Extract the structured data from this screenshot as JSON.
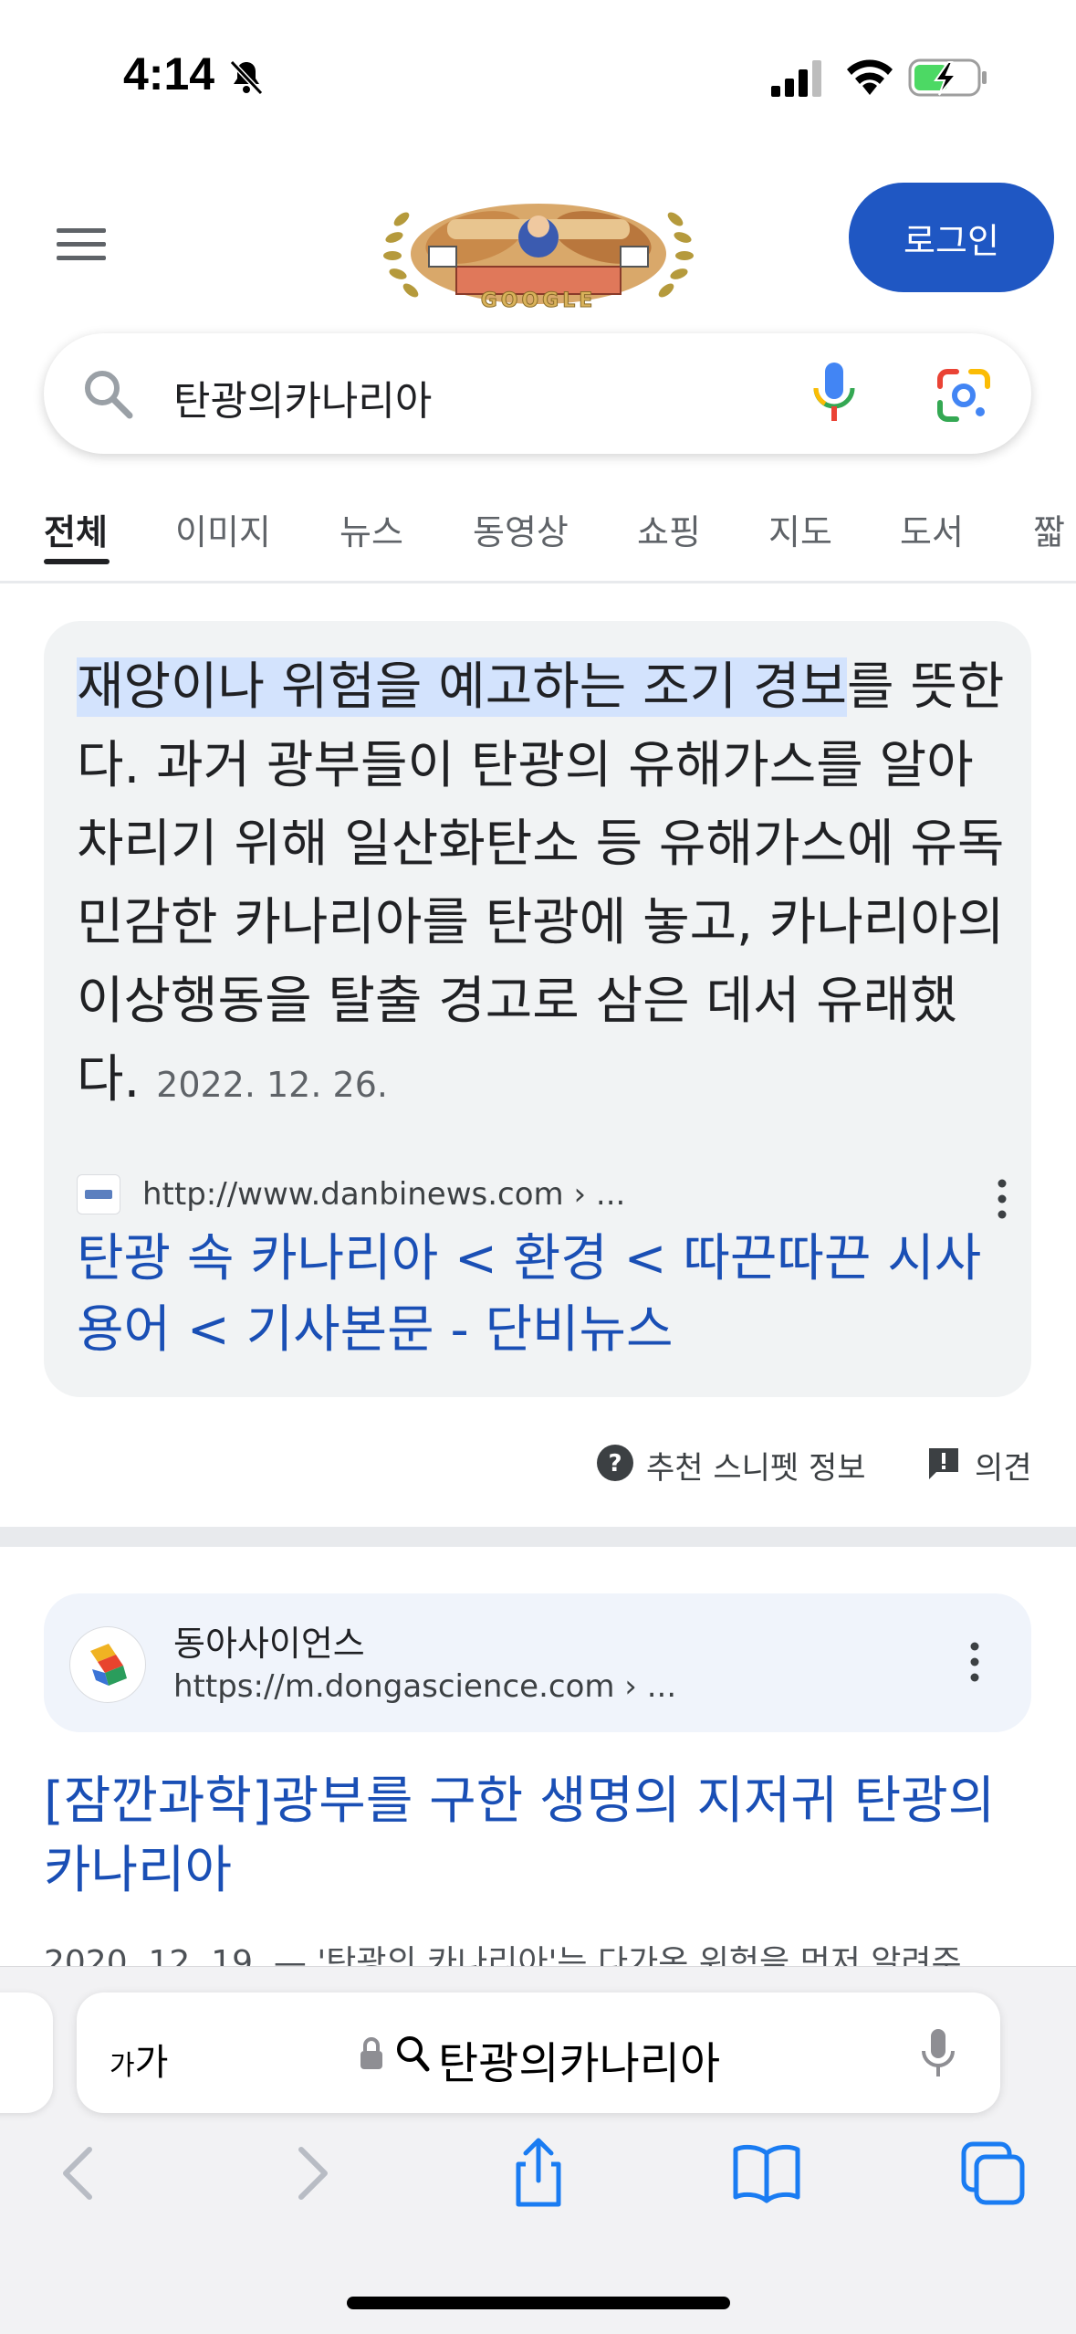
{
  "status_bar": {
    "time": "4:14"
  },
  "header": {
    "login_label": "로그인",
    "logo_text": "GOOGLE"
  },
  "search": {
    "query": "탄광의카나리아"
  },
  "tabs": [
    {
      "label": "전체"
    },
    {
      "label": "이미지"
    },
    {
      "label": "뉴스"
    },
    {
      "label": "동영상"
    },
    {
      "label": "쇼핑"
    },
    {
      "label": "지도"
    },
    {
      "label": "도서"
    },
    {
      "label": "짧"
    }
  ],
  "featured_snippet": {
    "highlighted_text": "재앙이나 위험을 예고하는 조기 경보",
    "body_text": "를 뜻한다. 과거 광부들이 탄광의 유해가스를 알아차리기 위해 일산화탄소 등 유해가스에 유독 민감한 카나리아를 탄광에 놓고, 카나리아의 이상행동을 탈출 경고로 삼은 데서 유래했다.",
    "date": "2022. 12. 26.",
    "source_url": "http://www.danbinews.com › ...",
    "link_title": "탄광 속 카나리아 < 환경 < 따끈따끈 시사용어 < 기사본문 - 단비뉴스"
  },
  "feedback": {
    "snippet_info": "추천 스니펫 정보",
    "feedback": "의견"
  },
  "result": {
    "site_name": "동아사이언스",
    "site_url": "https://m.dongascience.com › ...",
    "title": "[잠깐과학]광부를 구한 생명의 지저귀 탄광의 카나리아",
    "snippet": "2020. 12. 19. — '탄광의 카나리아'는 다가온 위험을 먼저 알려주"
  },
  "safari": {
    "text_size_small": "가",
    "text_size_large": "가",
    "address_text": "탄광의카나리아"
  },
  "colors": {
    "link": "#1a4fb5",
    "login_button": "#1f57c3",
    "highlight": "#d3e3fd"
  }
}
